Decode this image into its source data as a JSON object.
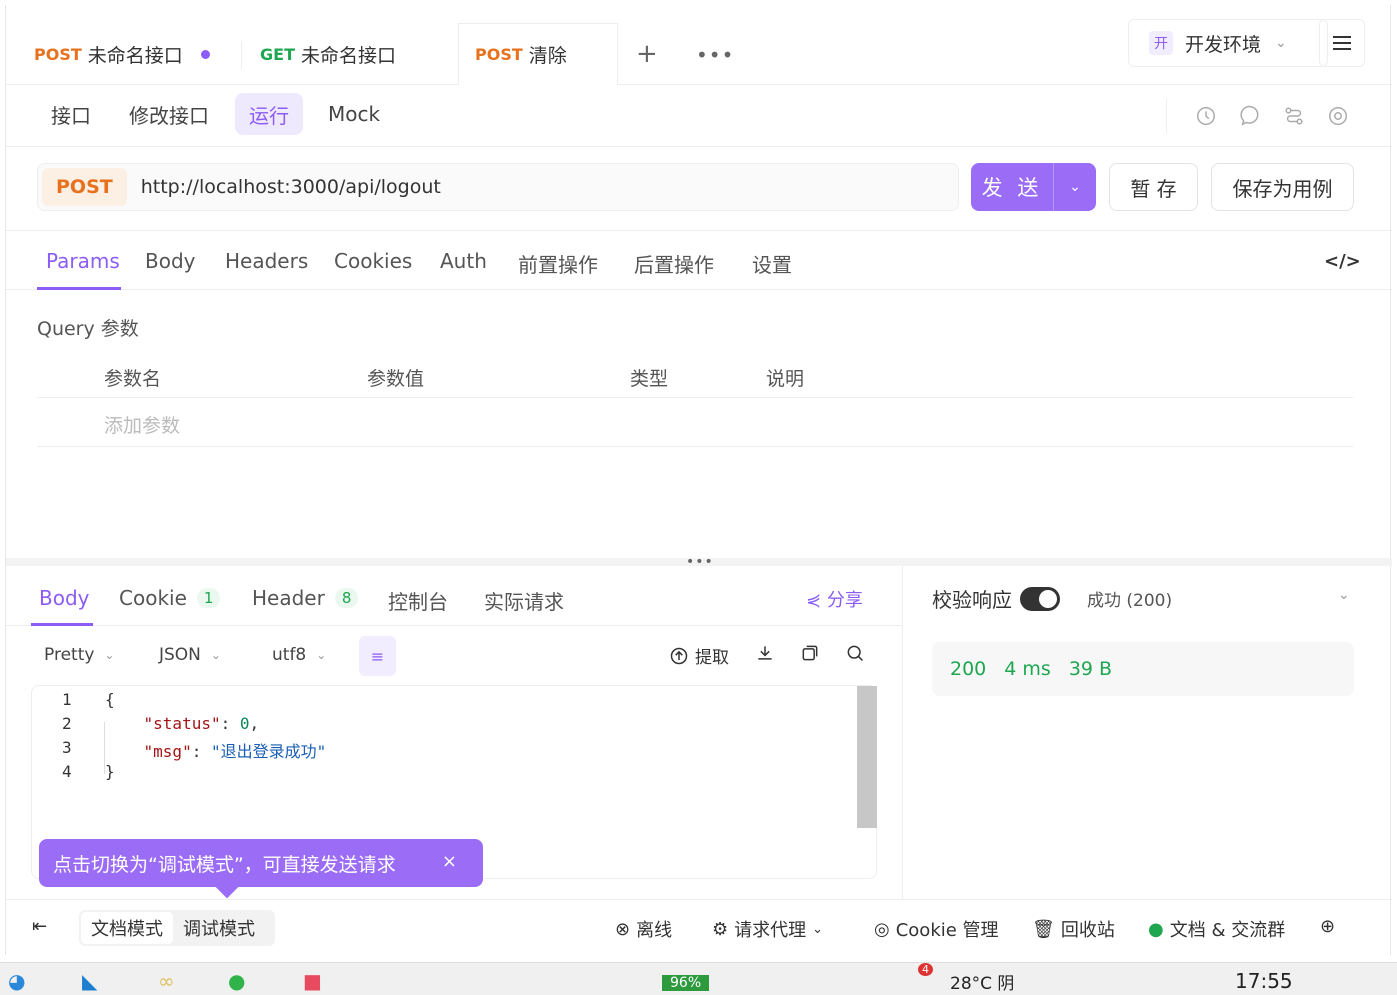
{
  "tabs": [
    {
      "method": "POST",
      "name": "未命名接口",
      "unsaved": true
    },
    {
      "method": "GET",
      "name": "未命名接口"
    },
    {
      "method": "POST",
      "name": "清除",
      "active": true
    }
  ],
  "tab_actions": {
    "add": "+",
    "more": "•••"
  },
  "env": {
    "badge": "开",
    "name": "开发环境"
  },
  "subnav": {
    "items": [
      "接口",
      "修改接口",
      "运行",
      "Mock"
    ],
    "active": "运行"
  },
  "request": {
    "method": "POST",
    "url": "http://localhost:3000/api/logout",
    "send_label": "发 送",
    "save_label": "暂 存",
    "save_as_example_label": "保存为用例"
  },
  "request_tabs": [
    "Params",
    "Body",
    "Headers",
    "Cookies",
    "Auth",
    "前置操作",
    "后置操作",
    "设置"
  ],
  "query": {
    "title": "Query 参数",
    "headers": [
      "参数名",
      "参数值",
      "类型",
      "说明"
    ],
    "add_placeholder": "添加参数"
  },
  "response_tabs": {
    "body": "Body",
    "cookie": "Cookie",
    "cookie_count": "1",
    "header": "Header",
    "header_count": "8",
    "console": "控制台",
    "actual": "实际请求",
    "share": "分享"
  },
  "response_toolbar": {
    "format": "Pretty",
    "lang": "JSON",
    "encoding": "utf8",
    "extract": "提取"
  },
  "validate": {
    "label": "校验响应",
    "status": "成功 (200)"
  },
  "result": {
    "code": "200",
    "time": "4 ms",
    "size": "39 B"
  },
  "code_lines": [
    {
      "n": "1",
      "text": "{"
    },
    {
      "n": "2",
      "key": "\"status\"",
      "value": "0"
    },
    {
      "n": "3",
      "key": "\"msg\"",
      "value": "\"退出登录成功\""
    },
    {
      "n": "4",
      "text": "}"
    }
  ],
  "tooltip": {
    "text": "点击切换为“调试模式”，可直接发送请求",
    "close": "×"
  },
  "bottom": {
    "modes": [
      "文档模式",
      "调试模式"
    ],
    "offline": "离线",
    "proxy": "请求代理",
    "cookie_mgr": "Cookie 管理",
    "recycle": "回收站",
    "docs": "文档 & 交流群"
  },
  "taskbar": {
    "battery": "96%",
    "weather": "28°C 阴",
    "time": "17:55",
    "badge": "4"
  }
}
